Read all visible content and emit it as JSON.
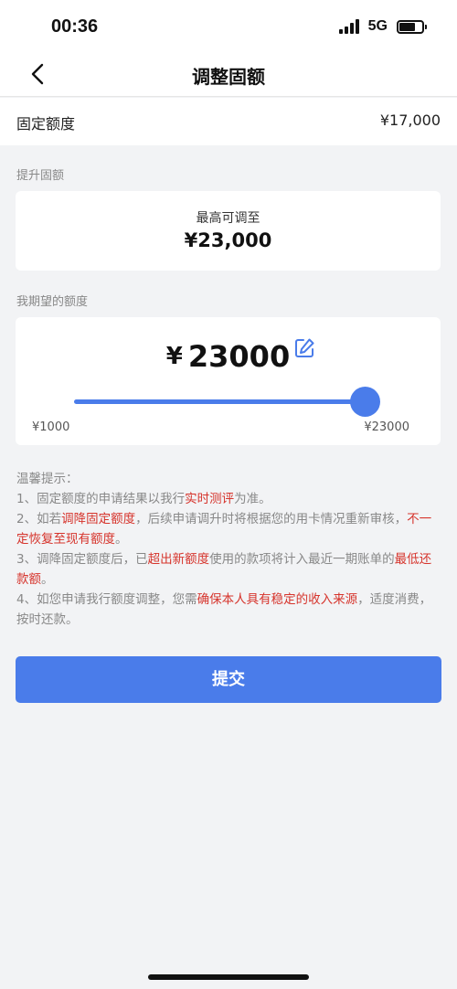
{
  "status_bar": {
    "time": "00:36",
    "network": "5G",
    "icons": [
      "signal-icon",
      "battery-icon"
    ]
  },
  "nav": {
    "title": "调整固额",
    "back_icon": "chevron-left-icon"
  },
  "fixed_limit": {
    "label": "固定额度",
    "value": "¥17,000"
  },
  "raise_section": {
    "label": "提升固额",
    "max_caption": "最高可调至",
    "max_value": "¥23,000"
  },
  "desired_section": {
    "label": "我期望的额度",
    "currency": "¥",
    "amount": "23000",
    "edit_icon": "edit-icon",
    "slider": {
      "min_label": "¥1000",
      "max_label": "¥23000",
      "level": 1.0
    }
  },
  "tips": {
    "title": "温馨提示：",
    "line1_a": "1、固定额度的申请结果以我行",
    "line1_b": "实时测评",
    "line1_c": "为准。",
    "line2_a": "2、如若",
    "line2_b": "调降固定额度",
    "line2_c": "，后续申请调升时将根据您的用卡情况重新审核，",
    "line2_d": "不一定恢复至现有额度",
    "line2_e": "。",
    "line3_a": "3、调降固定额度后，已",
    "line3_b": "超出新额度",
    "line3_c": "使用的款项将计入最近一期账单的",
    "line3_d": "最低还款额",
    "line3_e": "。",
    "line4_a": "4、如您申请我行额度调整，您需",
    "line4_b": "确保本人具有稳定的收入来源",
    "line4_c": "，适度消费，按时还款。"
  },
  "submit": {
    "label": "提交"
  },
  "colors": {
    "accent": "#4a7cea",
    "warning_text": "#d6342c",
    "background": "#f2f3f5"
  }
}
